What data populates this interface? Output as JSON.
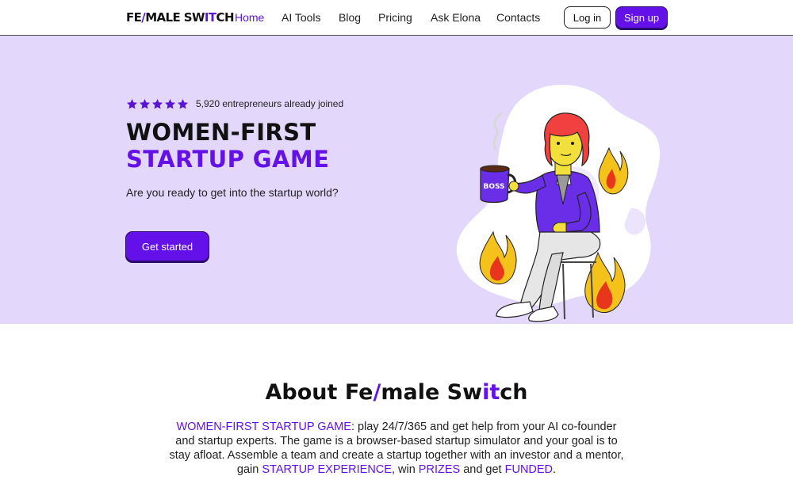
{
  "brand": {
    "logo_part1": "FE",
    "logo_slash": "/",
    "logo_part2": "MALE SW",
    "logo_it": "IT",
    "logo_part3": "CH",
    "accent_color": "#6410e8",
    "hero_bg": "#e3d8fb"
  },
  "nav": {
    "items": [
      {
        "label": "Home",
        "active": true
      },
      {
        "label": "AI Tools",
        "active": false
      },
      {
        "label": "Blog",
        "active": false
      },
      {
        "label": "Pricing",
        "active": false
      },
      {
        "label": "Ask Elona",
        "active": false
      },
      {
        "label": "Contacts",
        "active": false
      }
    ],
    "login_label": "Log in",
    "signup_label": "Sign up"
  },
  "hero": {
    "stars": 5,
    "rating_text": "5,920 entrepreneurs already joined",
    "title_line1": "WOMEN-FIRST",
    "title_line2": "STARTUP GAME",
    "subtitle": "Are you ready to get into the startup world?",
    "cta_label": "Get started",
    "mug_text": "BOSS"
  },
  "about": {
    "title_part1": "About Fe",
    "title_slash": "/",
    "title_part2": "male Sw",
    "title_it": "it",
    "title_part3": "ch",
    "p_lead": "WOMEN-FIRST STARTUP GAME",
    "p_1": ": play 24/7/365 and get help from your AI co-founder and startup experts. The game is a browser-based startup simulator and your goal is to stay afloat. Assemble a team and create a startup together with an investor and a mentor, gain ",
    "p_hl2": "STARTUP EXPERIENCE",
    "p_2": ", win ",
    "p_hl3": "PRIZES",
    "p_3": " and get ",
    "p_hl4": "FUNDED",
    "p_4": "."
  }
}
